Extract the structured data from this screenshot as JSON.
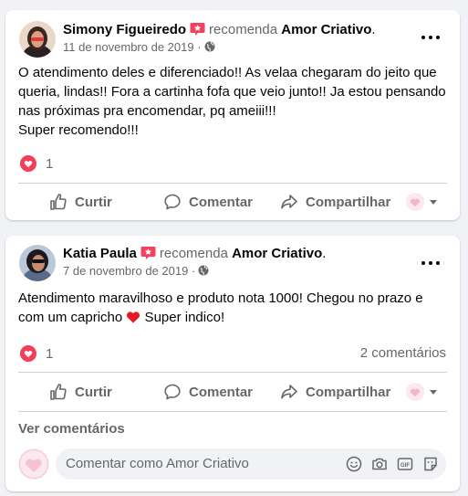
{
  "posts": [
    {
      "author": "Simony Figueiredo",
      "recommend_text": "recomenda",
      "page": "Amor Criativo",
      "date": "11 de novembro de 2019",
      "lines": [
        "O atendimento deles e diferenciado!! As velaa chegaram do jeito que",
        "queria, lindas!! Fora a cartinha fofa que veio junto!! Ja estou pensando",
        "nas próximas pra encomendar, pq ameiii!!!",
        "Super recomendo!!!"
      ],
      "reactions_count": "1",
      "actions": {
        "like": "Curtir",
        "comment": "Comentar",
        "share": "Compartilhar"
      }
    },
    {
      "author": "Katia Paula",
      "recommend_text": "recomenda",
      "page": "Amor Criativo",
      "date": "7 de novembro de 2019",
      "line1": "Atendimento maravilhoso e produto nota 1000! Chegou no prazo e",
      "line2_before": "com um capricho",
      "line2_after": " Super indico!",
      "reactions_count": "1",
      "comments_count": "2 comentários",
      "actions": {
        "like": "Curtir",
        "comment": "Comentar",
        "share": "Compartilhar"
      },
      "see_comments": "Ver comentários",
      "comment_placeholder": "Comentar como Amor Criativo"
    }
  ],
  "icons": [
    "recommend-badge-icon",
    "globe-icon",
    "more-options-icon",
    "love-reaction-icon",
    "like-icon",
    "comment-icon",
    "share-icon",
    "page-avatar-icon",
    "emoji-icon",
    "camera-icon",
    "gif-icon",
    "sticker-icon",
    "red-heart-emoji"
  ],
  "colors": {
    "recommend_badge": "#f3425f",
    "love": "#f33e58",
    "secondary_text": "#65676b",
    "divider": "#ced0d4"
  }
}
